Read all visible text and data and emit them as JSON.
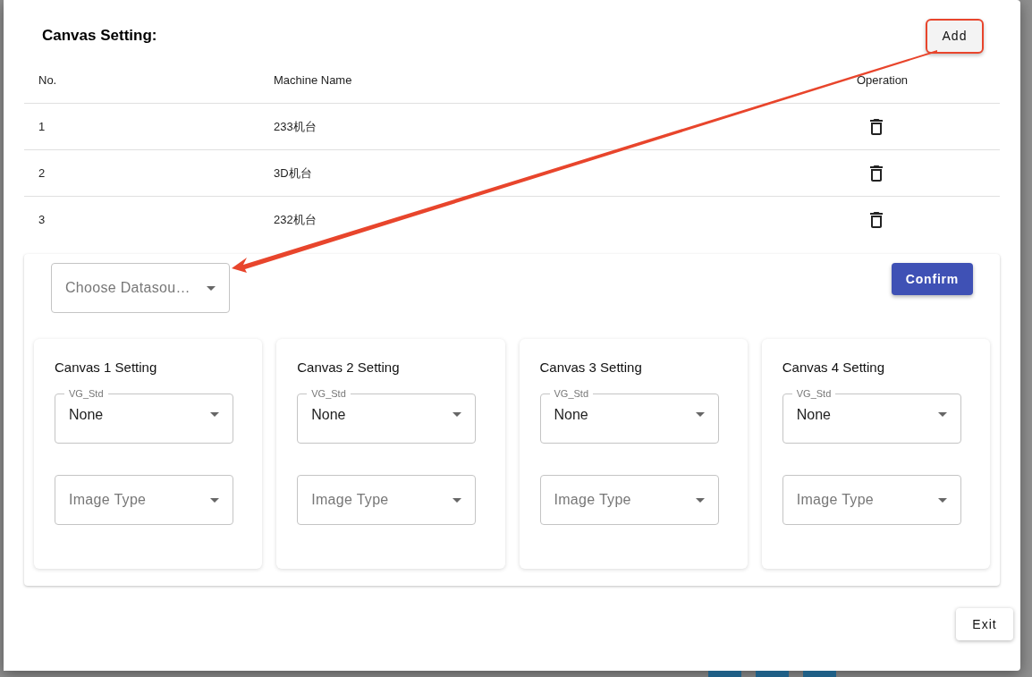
{
  "dialog": {
    "title": "Canvas Setting:",
    "add_button": "Add",
    "table": {
      "columns": [
        "No.",
        "Machine Name",
        "Operation"
      ],
      "rows": [
        {
          "no": "1",
          "machine_name": "233机台"
        },
        {
          "no": "2",
          "machine_name": "3D机台"
        },
        {
          "no": "3",
          "machine_name": "232机台"
        }
      ]
    },
    "datasource": {
      "placeholder": "Choose Datasou…"
    },
    "confirm_button": "Confirm",
    "canvases": [
      {
        "title": "Canvas 1 Setting",
        "vg_std": {
          "label": "VG_Std",
          "value": "None"
        },
        "image_type": {
          "placeholder": "Image Type"
        }
      },
      {
        "title": "Canvas 2 Setting",
        "vg_std": {
          "label": "VG_Std",
          "value": "None"
        },
        "image_type": {
          "placeholder": "Image Type"
        }
      },
      {
        "title": "Canvas 3 Setting",
        "vg_std": {
          "label": "VG_Std",
          "value": "None"
        },
        "image_type": {
          "placeholder": "Image Type"
        }
      },
      {
        "title": "Canvas 4 Setting",
        "vg_std": {
          "label": "VG_Std",
          "value": "None"
        },
        "image_type": {
          "placeholder": "Image Type"
        }
      }
    ],
    "exit_button": "Exit"
  }
}
